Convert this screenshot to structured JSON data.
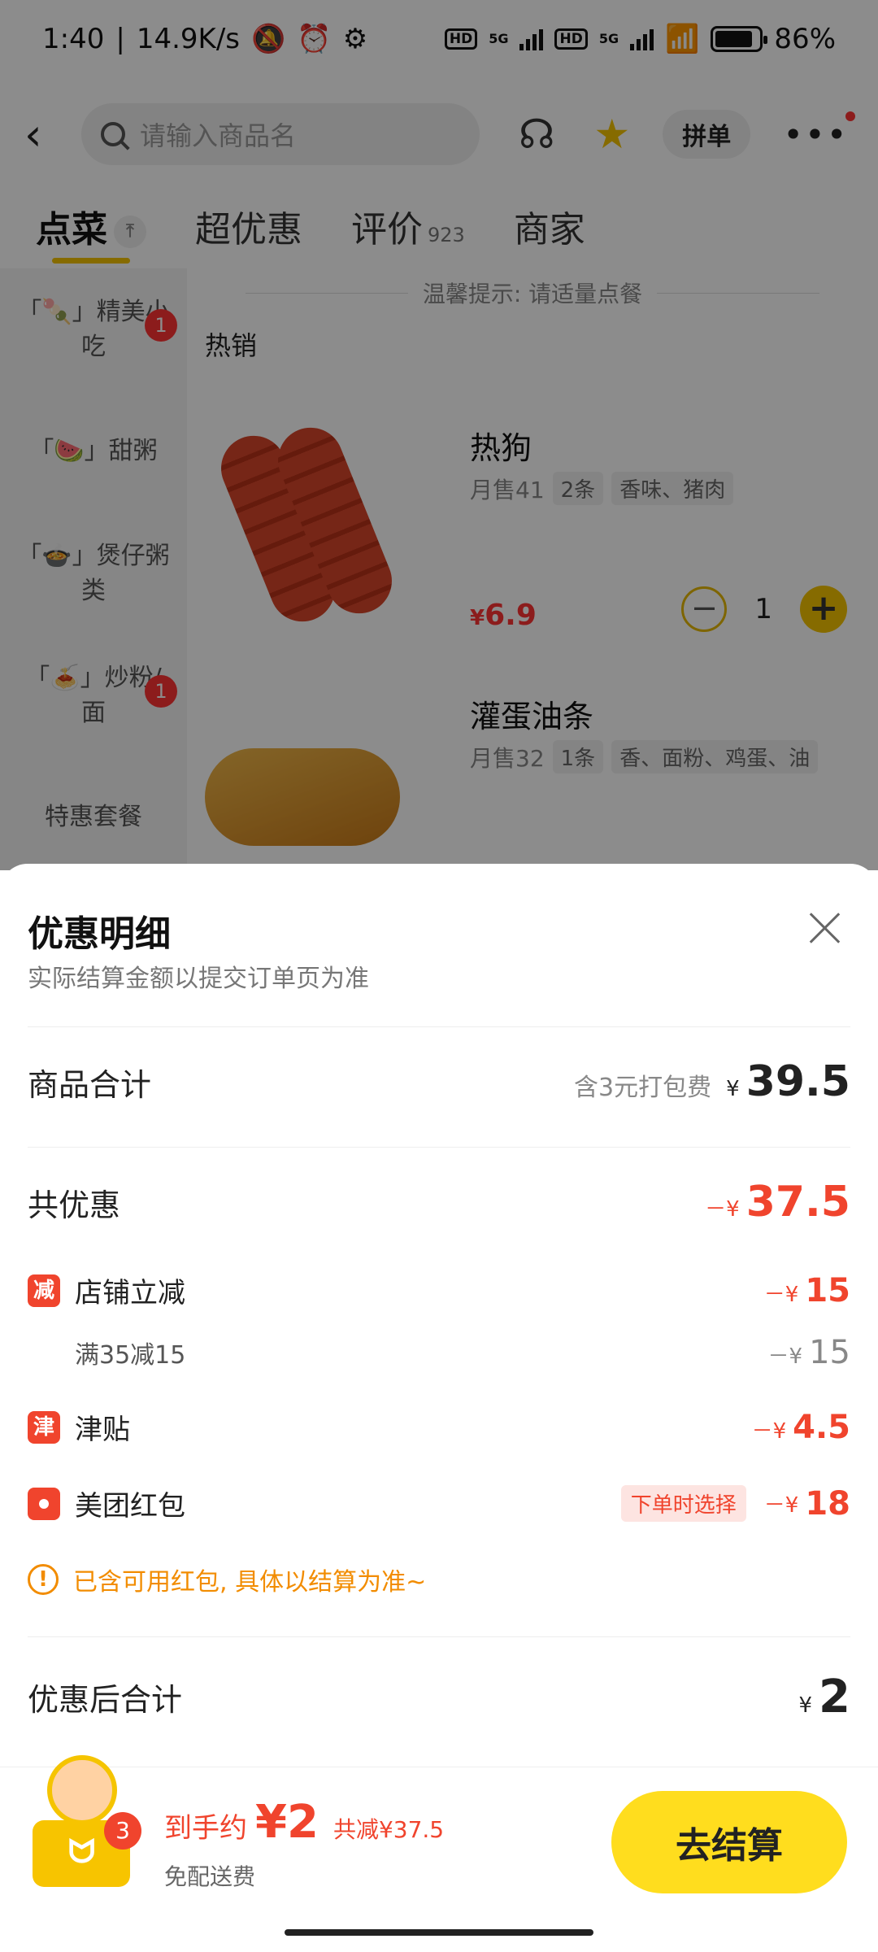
{
  "status": {
    "time": "1:40",
    "speed": "14.9K/s",
    "battery": "86",
    "net1": "HD",
    "net2": "5G"
  },
  "topbar": {
    "search_placeholder": "请输入商品名",
    "group_order": "拼单"
  },
  "tabs": [
    {
      "label": "点菜",
      "sub": ""
    },
    {
      "label": "超优惠",
      "sub": ""
    },
    {
      "label": "评价",
      "sub": "923"
    },
    {
      "label": "商家",
      "sub": ""
    }
  ],
  "categories": [
    {
      "label": "「🍡」精美小吃",
      "badge": "1"
    },
    {
      "label": "「🍉」甜粥",
      "badge": ""
    },
    {
      "label": "「🍲」煲仔粥类",
      "badge": ""
    },
    {
      "label": "「🍝」炒粉/面",
      "badge": "1"
    },
    {
      "label": "特惠套餐",
      "badge": ""
    }
  ],
  "menu": {
    "tip": "温馨提示: 请适量点餐",
    "section": "热销",
    "items": [
      {
        "name": "热狗",
        "sales": "月售41",
        "tags": [
          "2条",
          "香味、猪肉"
        ],
        "price": "6.9",
        "qty": "1"
      },
      {
        "name": "灌蛋油条",
        "sales": "月售32",
        "tags": [
          "1条",
          "香、面粉、鸡蛋、油"
        ]
      }
    ]
  },
  "sheet": {
    "title": "优惠明细",
    "subtitle": "实际结算金额以提交订单页为准",
    "goods_total": {
      "label": "商品合计",
      "note": "含3元打包费",
      "yen": "¥",
      "amount": "39.5"
    },
    "discount_total": {
      "label": "共优惠",
      "amount": "37.5",
      "prefix": "－¥"
    },
    "store_discount": {
      "icon": "减",
      "label": "店铺立减",
      "amount": "15",
      "prefix": "－¥"
    },
    "store_rule": {
      "label": "满35减15",
      "amount": "15",
      "prefix": "－¥"
    },
    "subsidy": {
      "icon": "津",
      "label": "津贴",
      "amount": "4.5",
      "prefix": "－¥"
    },
    "red_packet": {
      "label": "美团红包",
      "chip": "下单时选择",
      "amount": "18",
      "prefix": "－¥"
    },
    "warning": "已含可用红包, 具体以结算为准~",
    "final": {
      "label": "优惠后合计",
      "yen": "¥",
      "amount": "2"
    }
  },
  "bottom": {
    "cart_count": "3",
    "pay_label": "到手约",
    "pay_amount": "¥2",
    "saved": "共减¥37.5",
    "delivery": "免配送费",
    "checkout": "去结算"
  },
  "colors": {
    "accent": "#f5c400",
    "discount_red": "#f0442d",
    "warning": "#f28c00"
  }
}
